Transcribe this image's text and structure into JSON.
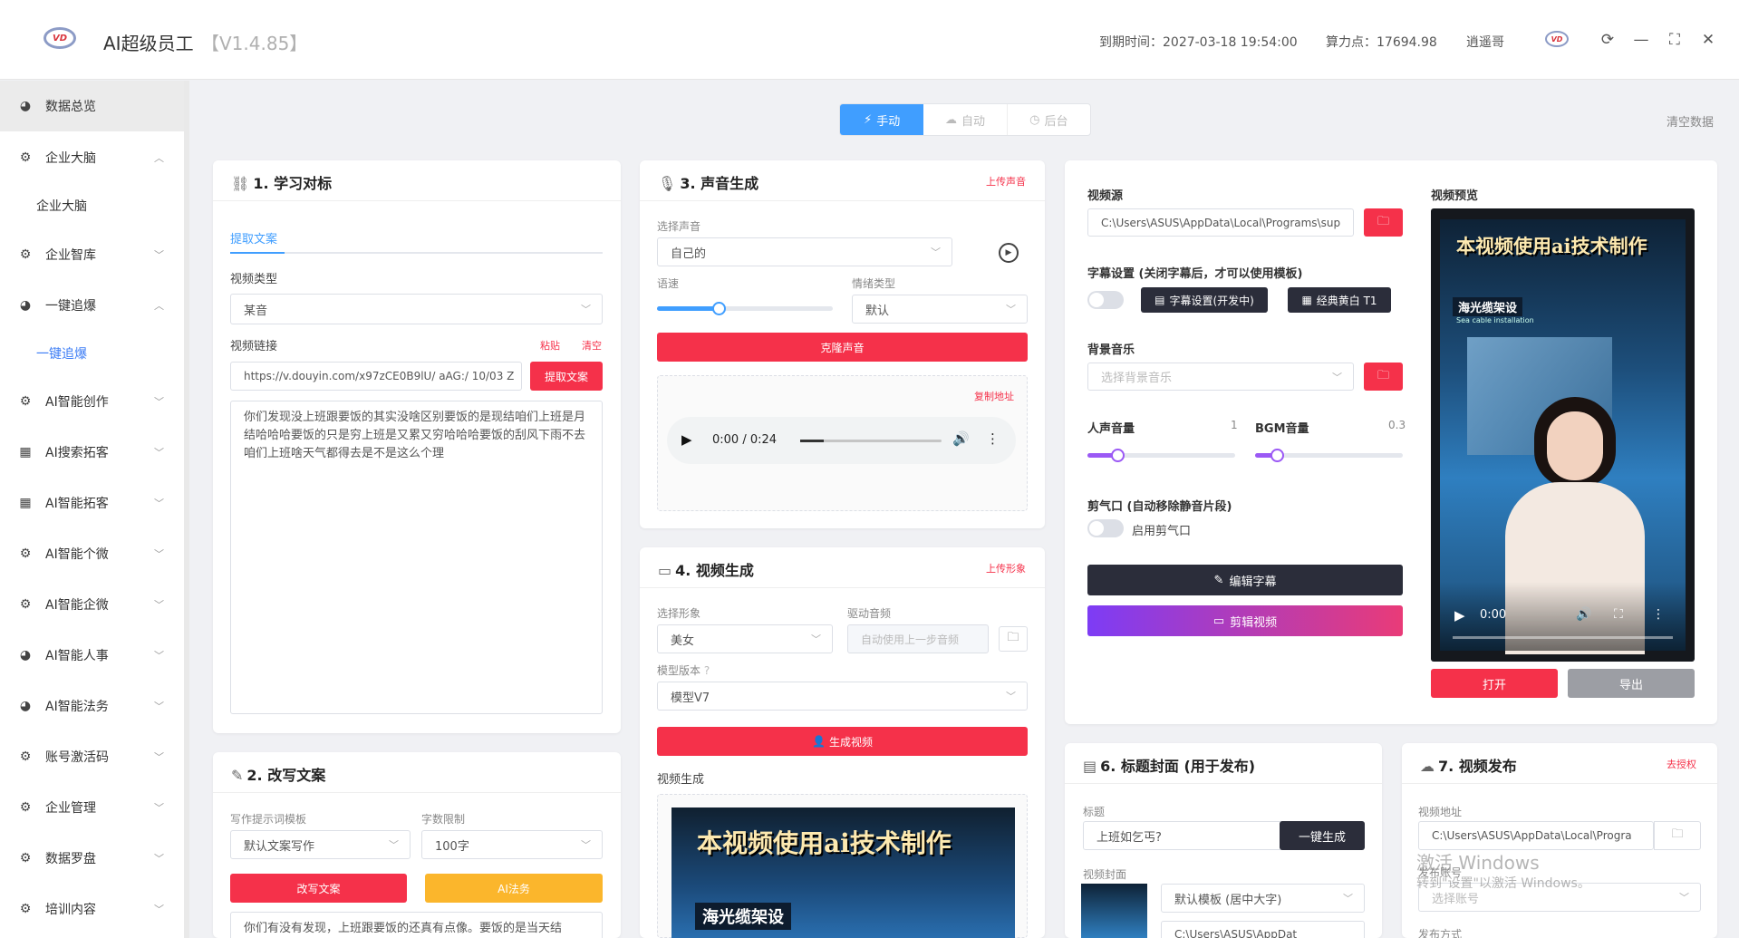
{
  "header": {
    "title": "AI超级员工",
    "version": "【V1.4.85】",
    "expire": "到期时间：2027-03-18 19:54:00",
    "points": "算力点：17694.98",
    "user": "逍遥哥",
    "logo": "VD"
  },
  "sidebar": {
    "items": [
      {
        "label": "数据总览",
        "icon": "dashboard-icon"
      },
      {
        "label": "企业大脑",
        "icon": "gear-icon"
      },
      {
        "label": "企业大脑",
        "sub": true
      },
      {
        "label": "企业智库",
        "icon": "gear-icon"
      },
      {
        "label": "一键追爆",
        "icon": "dashboard-icon"
      },
      {
        "label": "一键追爆",
        "sub": true
      },
      {
        "label": "AI智能创作",
        "icon": "gear-icon"
      },
      {
        "label": "AI搜索拓客",
        "icon": "grid-icon"
      },
      {
        "label": "AI智能拓客",
        "icon": "grid-icon"
      },
      {
        "label": "AI智能个微",
        "icon": "gear-icon"
      },
      {
        "label": "AI智能企微",
        "icon": "gear-icon"
      },
      {
        "label": "AI智能人事",
        "icon": "dashboard-icon"
      },
      {
        "label": "AI智能法务",
        "icon": "dashboard-icon"
      },
      {
        "label": "账号激活码",
        "icon": "gear-icon"
      },
      {
        "label": "企业管理",
        "icon": "gear-icon"
      },
      {
        "label": "数据罗盘",
        "icon": "gear-icon"
      },
      {
        "label": "培训内容",
        "icon": "gear-icon"
      }
    ]
  },
  "modes": {
    "manual": "手动",
    "auto": "自动",
    "backend": "后台",
    "clear": "清空数据"
  },
  "learn": {
    "title": "1. 学习对标",
    "tab": "提取文案",
    "type_label": "视频类型",
    "type_value": "某音",
    "link_label": "视频链接",
    "paste": "粘贴",
    "clear": "清空",
    "link_value": "https://v.douyin.com/x97zCE0B9lU/ aAG:/ 10/03 Z",
    "extract_btn": "提取文案",
    "text": "你们发现没上班跟要饭的其实没啥区别要饭的是现结咱们上班是月结哈哈哈要饭的只是穷上班是又累又穷哈哈哈要饭的刮风下雨不去咱们上班啥天气都得去是不是这么个理"
  },
  "rewrite": {
    "title": "2. 改写文案",
    "tpl_label": "写作提示词模板",
    "tpl_value": "默认文案写作",
    "limit_label": "字数限制",
    "limit_value": "100字",
    "rewrite_btn": "改写文案",
    "law_btn": "AI法务",
    "text": "你们有没有发现，上班跟要饭的还真有点像。要饭的是当天结"
  },
  "voice": {
    "title": "3. 声音生成",
    "upload": "上传声音",
    "voice_label": "选择声音",
    "voice_value": "自己的",
    "speed_label": "语速",
    "speed_value": 0.35,
    "emotion_label": "情绪类型",
    "emotion_value": "默认",
    "clone_btn": "克隆声音",
    "copy": "复制地址",
    "time": "0:00 / 0:24"
  },
  "video": {
    "title": "4. 视频生成",
    "upload": "上传形象",
    "avatar_label": "选择形象",
    "avatar_value": "美女",
    "audio_label": "驱动音频",
    "audio_placeholder": "自动使用上一步音频",
    "model_label": "模型版本",
    "model_value": "模型V7",
    "gen_btn": "生成视频",
    "gen_label": "视频生成",
    "overlay": "本视频使用ai技术制作",
    "overlay2": "海光缆架设"
  },
  "source": {
    "src_label": "视频源",
    "src_value": "C:\\Users\\ASUS\\AppData\\Local\\Programs\\sup",
    "sub_label": "字幕设置 (关闭字幕后，才可以使用模板)",
    "sub_btn": "字幕设置(开发中)",
    "sub_tpl": "经典黄白 T1",
    "bgm_label": "背景音乐",
    "bgm_placeholder": "选择背景音乐",
    "voice_vol_label": "人声音量",
    "voice_vol": "1",
    "bgm_vol_label": "BGM音量",
    "bgm_vol": "0.3",
    "voice_vol_level": 0.2,
    "bgm_vol_level": 0.15,
    "trim_label": "剪气口 (自动移除静音片段)",
    "trim_toggle": "启用剪气口",
    "edit_sub_btn": "编辑字幕",
    "cut_btn": "剪辑视频"
  },
  "preview": {
    "label": "视频预览",
    "overlay": "本视频使用ai技术制作",
    "overlay2": "海光缆架设",
    "overlay3": "Sea cable installation",
    "time": "0:00",
    "open_btn": "打开",
    "export_btn": "导出"
  },
  "cover": {
    "title": "6. 标题封面 (用于发布)",
    "t_label": "标题",
    "t_value": "上班如乞丐?",
    "gen_btn": "一键生成",
    "cover_label": "视频封面",
    "tpl_value": "默认模板 (居中大字)",
    "path_value": "C:\\Users\\ASUS\\AppDat"
  },
  "publish": {
    "title": "7. 视频发布",
    "auth": "去授权",
    "addr_label": "视频地址",
    "addr_value": "C:\\Users\\ASUS\\AppData\\Local\\Progra",
    "acct_label": "发布账号",
    "acct_placeholder": "选择账号",
    "method_label": "发布方式"
  },
  "watermark": {
    "line1": "激活 Windows",
    "line2": "转到\"设置\"以激活 Windows。"
  }
}
